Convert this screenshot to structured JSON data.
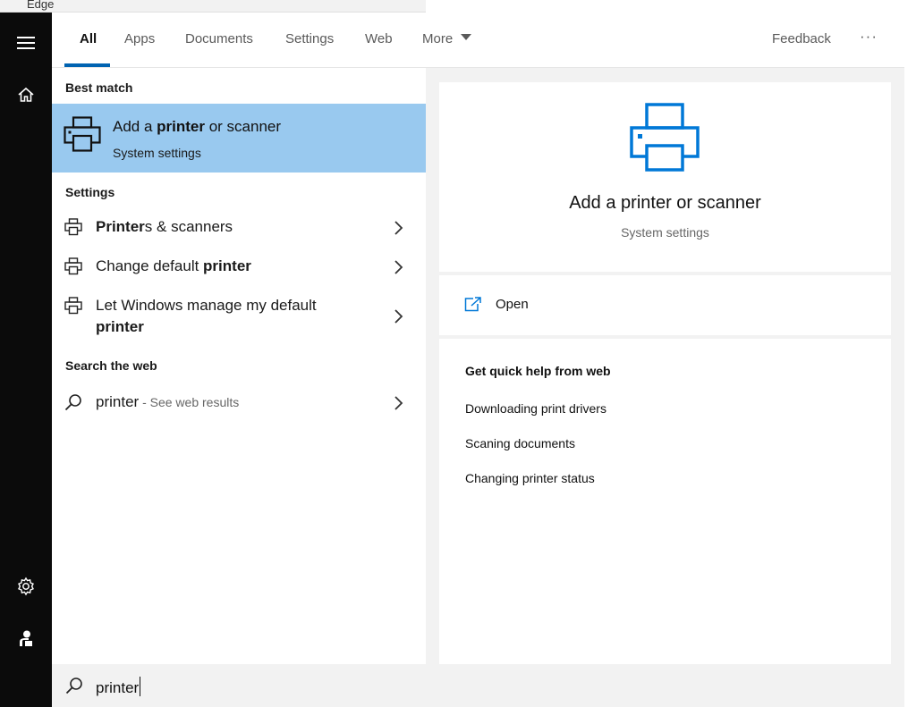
{
  "window": {
    "edge_label": "Edge"
  },
  "tabs": {
    "all": "All",
    "apps": "Apps",
    "documents": "Documents",
    "settings": "Settings",
    "web": "Web",
    "more": "More",
    "feedback": "Feedback",
    "overflow": "···"
  },
  "left": {
    "best_match_heading": "Best match",
    "best_match": {
      "title_pre": "Add a ",
      "title_bold": "printer",
      "title_post": " or scanner",
      "subtitle": "System settings"
    },
    "settings_heading": "Settings",
    "settings_items": [
      {
        "bold": "Printer",
        "rest": "s & scanners"
      },
      {
        "pre": "Change default ",
        "bold": "printer"
      },
      {
        "line1": "Let Windows manage my default",
        "line2_bold": "printer"
      }
    ],
    "web_heading": "Search the web",
    "web_item": {
      "query": "printer",
      "suffix": " - See web results"
    }
  },
  "right": {
    "title": "Add a printer or scanner",
    "subtitle": "System settings",
    "open_label": "Open",
    "help_heading": "Get quick help from web",
    "help_links": [
      "Downloading print drivers",
      "Scaning documents",
      "Changing printer status"
    ]
  },
  "search": {
    "value": "printer"
  },
  "colors": {
    "accent": "#0063b1",
    "selected_bg": "#99c9ef",
    "rail_bg": "#0b0b0b",
    "icon_blue": "#0078d7"
  },
  "icons": [
    "hamburger-icon",
    "home-icon",
    "settings-gear-icon",
    "user-icon",
    "printer-icon",
    "chevron-right-icon",
    "search-icon",
    "open-external-icon",
    "chevron-down-icon"
  ]
}
